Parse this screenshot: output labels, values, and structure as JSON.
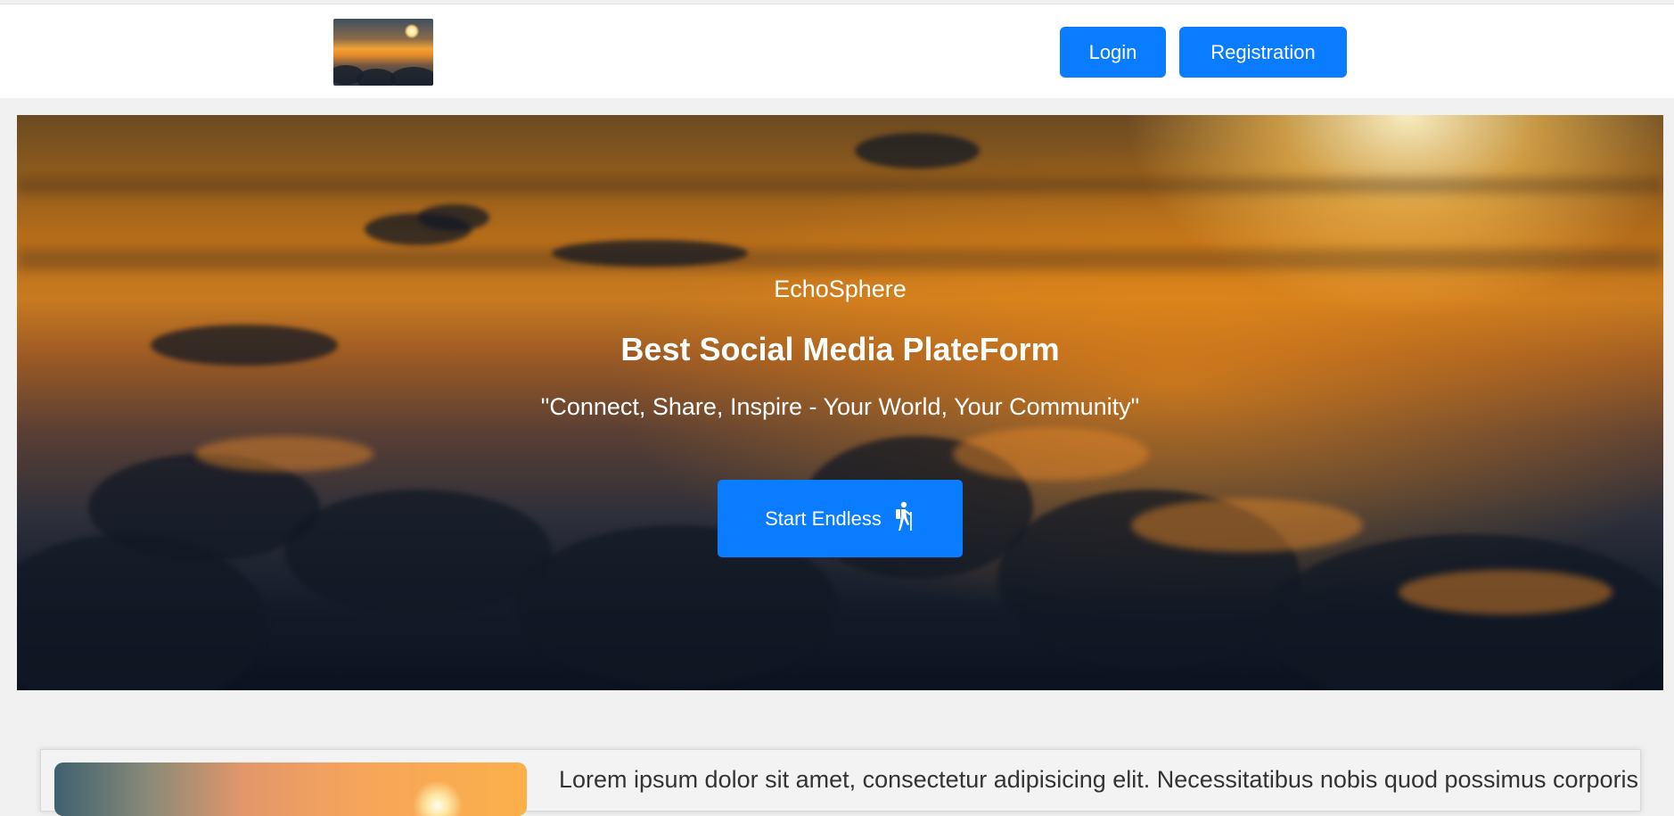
{
  "header": {
    "logo_alt": "sunset over clouds logo",
    "login_label": "Login",
    "register_label": "Registration"
  },
  "hero": {
    "brand": "EchoSphere",
    "headline": "Best Social Media PlateForm",
    "tagline": "\"Connect, Share, Inspire - Your World, Your Community\"",
    "cta_label": "Start Endless",
    "cta_icon": "hiking-person-icon"
  },
  "card": {
    "text": "Lorem ipsum dolor sit amet, consectetur adipisicing elit. Necessitatibus nobis quod possimus corporis"
  },
  "colors": {
    "accent": "#0a7cff",
    "page_bg": "#f0f0f0"
  }
}
